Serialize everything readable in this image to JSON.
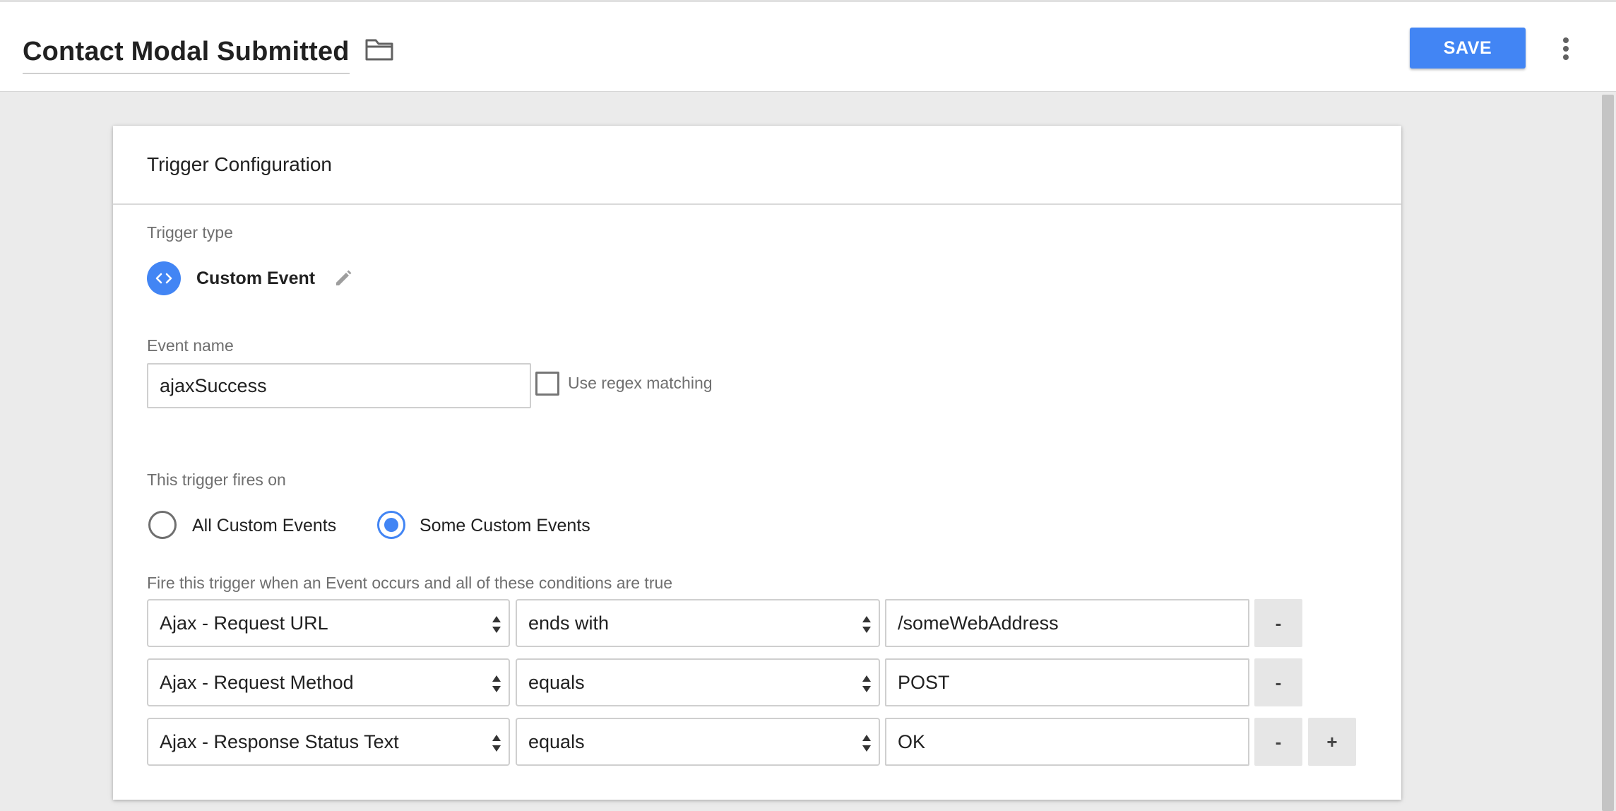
{
  "header": {
    "title": "Contact Modal Submitted",
    "save_label": "SAVE",
    "folder_icon": "folder-icon",
    "more_icon": "more-vertical-icon"
  },
  "colors": {
    "accent": "#4285f4",
    "background": "#ebebeb",
    "card": "#ffffff"
  },
  "card": {
    "title": "Trigger Configuration",
    "trigger_type": {
      "label": "Trigger type",
      "name": "Custom Event",
      "icon": "code-brackets-icon",
      "edit_icon": "pencil-icon"
    },
    "event_name": {
      "label": "Event name",
      "value": "ajaxSuccess",
      "regex_label": "Use regex matching",
      "regex_checked": false
    },
    "fires_on": {
      "label": "This trigger fires on",
      "options": [
        {
          "label": "All Custom Events",
          "selected": false
        },
        {
          "label": "Some Custom Events",
          "selected": true
        }
      ]
    },
    "conditions": {
      "label": "Fire this trigger when an Event occurs and all of these conditions are true",
      "rows": [
        {
          "variable": "Ajax - Request URL",
          "operator": "ends with",
          "value": "/someWebAddress",
          "remove_label": "-"
        },
        {
          "variable": "Ajax - Request Method",
          "operator": "equals",
          "value": "POST",
          "remove_label": "-"
        },
        {
          "variable": "Ajax - Response Status Text",
          "operator": "equals",
          "value": "OK",
          "remove_label": "-",
          "add_label": "+"
        }
      ]
    }
  }
}
